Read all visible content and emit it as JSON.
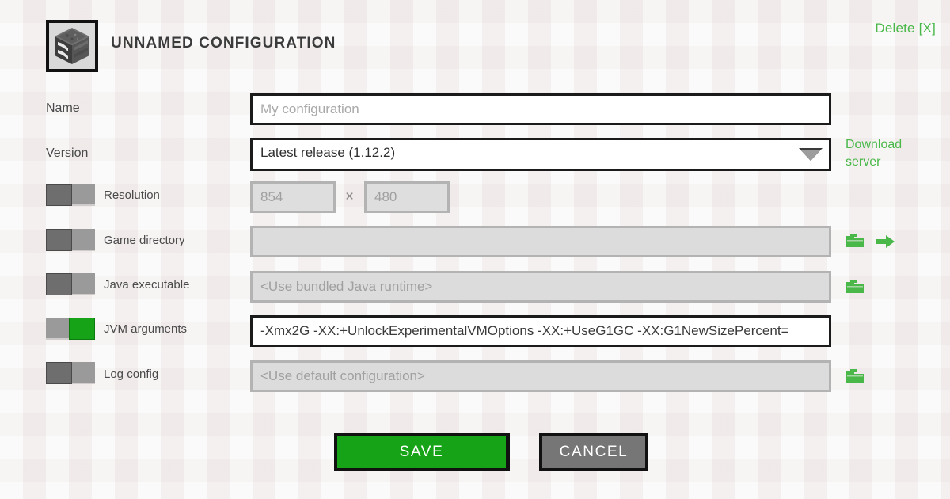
{
  "header": {
    "icon_name": "minecraft-block-icon",
    "title": "UNNAMED CONFIGURATION",
    "delete_label": "Delete [X]"
  },
  "colors": {
    "accent_green": "#49b849",
    "button_green": "#17a317",
    "button_gray": "#767676",
    "background": "#f4efee",
    "border_dark": "#1b1b1b",
    "disabled_fill": "#dcdcdc",
    "placeholder_text": "#a9a9a9"
  },
  "form": {
    "name": {
      "label": "Name",
      "value": "",
      "placeholder": "My configuration"
    },
    "version": {
      "label": "Version",
      "selected": "Latest release (1.12.2)",
      "download_server_label": "Download server"
    },
    "resolution": {
      "label": "Resolution",
      "enabled": false,
      "width_value": "854",
      "height_value": "480",
      "separator": "×"
    },
    "game_directory": {
      "label": "Game directory",
      "enabled": false,
      "value": "",
      "placeholder": "",
      "browse_icon": "folder-icon",
      "open_icon": "arrow-right-icon"
    },
    "java_executable": {
      "label": "Java executable",
      "enabled": false,
      "value": "",
      "placeholder": "<Use bundled Java runtime>",
      "browse_icon": "folder-icon"
    },
    "jvm_arguments": {
      "label": "JVM arguments",
      "enabled": true,
      "value": "-Xmx2G -XX:+UnlockExperimentalVMOptions -XX:+UseG1GC -XX:G1NewSizePercent="
    },
    "log_config": {
      "label": "Log config",
      "enabled": false,
      "value": "",
      "placeholder": "<Use default configuration>",
      "browse_icon": "folder-icon"
    }
  },
  "actions": {
    "save_label": "SAVE",
    "cancel_label": "CANCEL"
  }
}
